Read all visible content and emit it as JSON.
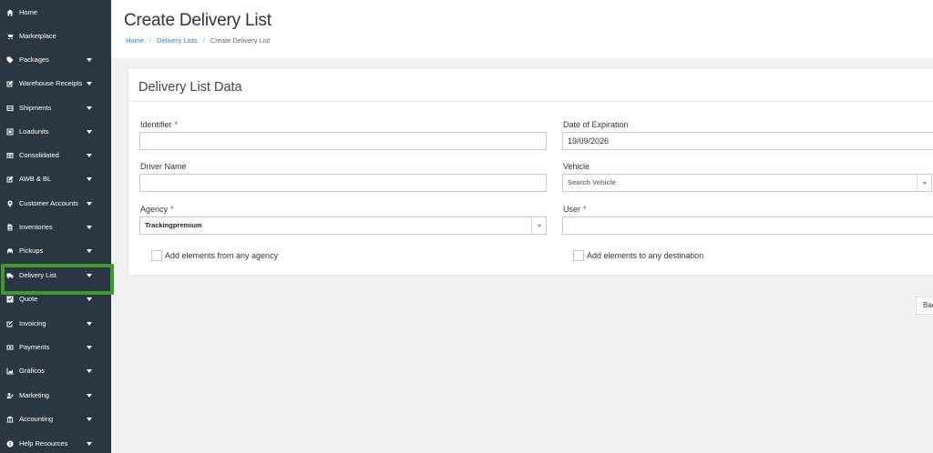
{
  "sidebar": {
    "items": [
      {
        "label": "Home",
        "icon": "home-icon",
        "caret": false
      },
      {
        "label": "Marketplace",
        "icon": "cart-icon",
        "caret": false
      },
      {
        "label": "Packages",
        "icon": "tags-icon",
        "caret": true
      },
      {
        "label": "Warehouse Receipts",
        "icon": "edit-icon",
        "caret": true
      },
      {
        "label": "Shipments",
        "icon": "list-icon",
        "caret": true
      },
      {
        "label": "Loadunits",
        "icon": "box-icon",
        "caret": true
      },
      {
        "label": "Consolidated",
        "icon": "table-icon",
        "caret": true
      },
      {
        "label": "AWB & BL",
        "icon": "pencil-square-icon",
        "caret": true
      },
      {
        "label": "Customer Accounts",
        "icon": "map-marker-icon",
        "caret": true
      },
      {
        "label": "Inventories",
        "icon": "document-icon",
        "caret": true
      },
      {
        "label": "Pickups",
        "icon": "car-icon",
        "caret": true
      },
      {
        "label": "Delivery List",
        "icon": "truck-icon",
        "caret": true
      },
      {
        "label": "Quote",
        "icon": "check-square-icon",
        "caret": true
      },
      {
        "label": "Invoicing",
        "icon": "check-edit-icon",
        "caret": true
      },
      {
        "label": "Payments",
        "icon": "money-icon",
        "caret": true
      },
      {
        "label": "Gráficos",
        "icon": "area-chart-icon",
        "caret": true
      },
      {
        "label": "Marketing",
        "icon": "user-plus-icon",
        "caret": true
      },
      {
        "label": "Accounting",
        "icon": "bank-icon",
        "caret": true
      },
      {
        "label": "Help Resources",
        "icon": "info-circle-icon",
        "caret": true
      }
    ]
  },
  "header": {
    "title": "Create Delivery List",
    "breadcrumb": [
      "Home",
      "Delivery Lists",
      "Create Delivery List"
    ]
  },
  "panel": {
    "title": "Delivery List Data",
    "identifier_label": "Identifier",
    "identifier_value": "",
    "expiration_label": "Date of Expiration",
    "expiration_value": "19/09/2026",
    "driver_label": "Driver Name",
    "driver_value": "",
    "vehicle_label": "Vehicle",
    "vehicle_placeholder": "Search Vehicle",
    "agency_label": "Agency",
    "agency_value": "Trackingpremium",
    "user_label": "User",
    "user_value": "",
    "required_mark": "*",
    "chk_any_agency": "Add elements from any agency",
    "chk_any_destination": "Add elements to any destination"
  },
  "actions": {
    "back_label": "Bac"
  },
  "colors": {
    "sidebar_bg": "#2b3643",
    "highlight": "#3e9a2a",
    "required": "#e02222",
    "link": "#337ab7"
  }
}
